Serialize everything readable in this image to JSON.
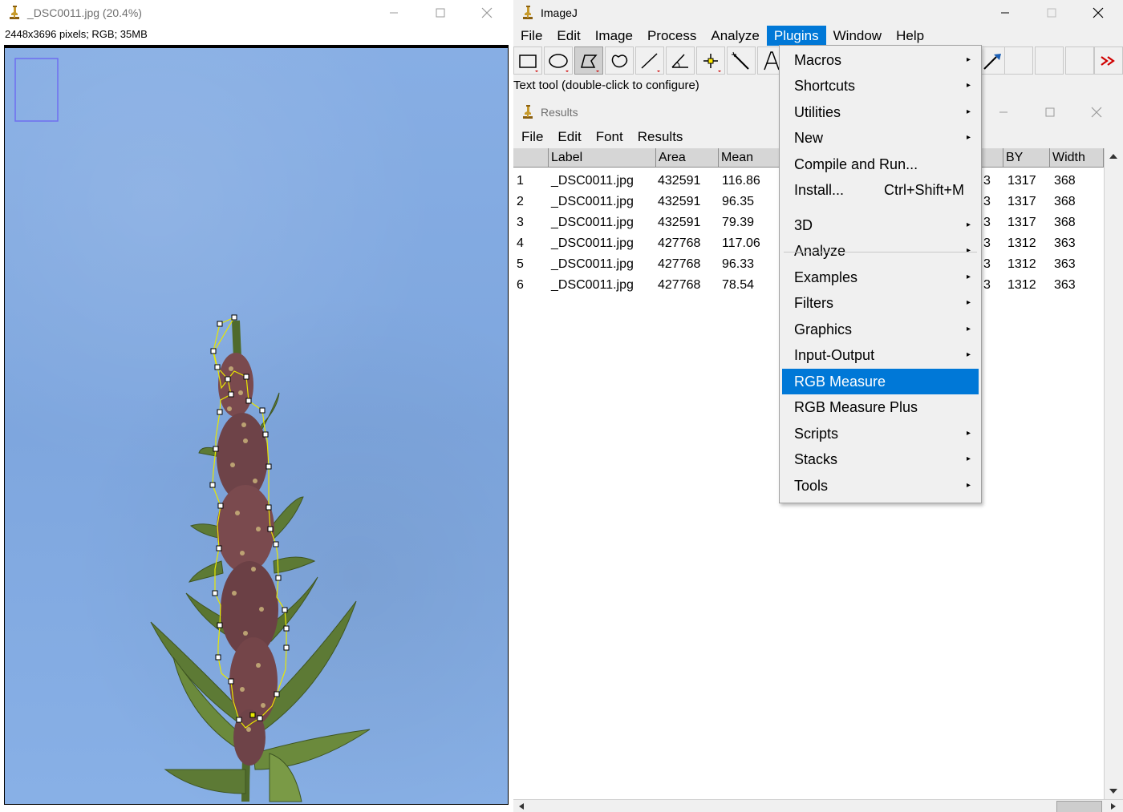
{
  "image_window": {
    "title": "_DSC0011.jpg (20.4%)",
    "info": "2448x3696 pixels; RGB; 35MB"
  },
  "imagej_window": {
    "title": "ImageJ",
    "menu": [
      "File",
      "Edit",
      "Image",
      "Process",
      "Analyze",
      "Plugins",
      "Window",
      "Help"
    ],
    "active_menu": "Plugins",
    "status": "Text tool (double-click to configure)",
    "tools": [
      "rectangle-tool",
      "oval-tool",
      "polygon-tool",
      "freehand-tool",
      "line-tool",
      "angle-tool",
      "point-tool",
      "wand-tool",
      "text-tool",
      "dropper-tool",
      "more-tools"
    ]
  },
  "results_window": {
    "title": "Results",
    "menu": [
      "File",
      "Edit",
      "Font",
      "Results"
    ],
    "columns": [
      "Label",
      "Area",
      "Mean",
      "BY",
      "Width"
    ],
    "rows": [
      {
        "num": "1",
        "label": "_DSC0011.jpg",
        "area": "432591",
        "mean": "116.86",
        "bx": "3",
        "by": "1317",
        "width": "368"
      },
      {
        "num": "2",
        "label": "_DSC0011.jpg",
        "area": "432591",
        "mean": "96.35",
        "bx": "3",
        "by": "1317",
        "width": "368"
      },
      {
        "num": "3",
        "label": "_DSC0011.jpg",
        "area": "432591",
        "mean": "79.39",
        "bx": "3",
        "by": "1317",
        "width": "368"
      },
      {
        "num": "4",
        "label": "_DSC0011.jpg",
        "area": "427768",
        "mean": "117.06",
        "bx": "3",
        "by": "1312",
        "width": "363"
      },
      {
        "num": "5",
        "label": "_DSC0011.jpg",
        "area": "427768",
        "mean": "96.33",
        "bx": "3",
        "by": "1312",
        "width": "363"
      },
      {
        "num": "6",
        "label": "_DSC0011.jpg",
        "area": "427768",
        "mean": "78.54",
        "bx": "3",
        "by": "1312",
        "width": "363"
      }
    ]
  },
  "plugins_menu": {
    "items": [
      {
        "label": "Macros",
        "submenu": true
      },
      {
        "label": "Shortcuts",
        "submenu": true
      },
      {
        "label": "Utilities",
        "submenu": true
      },
      {
        "label": "New",
        "submenu": true
      },
      {
        "label": "Compile and Run...",
        "submenu": false
      },
      {
        "label": "Install...",
        "submenu": false,
        "accelerator": "Ctrl+Shift+M"
      },
      {
        "label": "3D",
        "submenu": true
      },
      {
        "label": "Analyze",
        "submenu": true
      },
      {
        "label": "Examples",
        "submenu": true
      },
      {
        "label": "Filters",
        "submenu": true
      },
      {
        "label": "Graphics",
        "submenu": true
      },
      {
        "label": "Input-Output",
        "submenu": true
      },
      {
        "label": "RGB Measure",
        "submenu": false,
        "highlighted": true
      },
      {
        "label": "RGB Measure Plus",
        "submenu": false
      },
      {
        "label": "Scripts",
        "submenu": true
      },
      {
        "label": "Stacks",
        "submenu": true
      },
      {
        "label": "Tools",
        "submenu": true
      }
    ]
  },
  "colors": {
    "highlight": "#0078d7",
    "background_blue": "#87aee4",
    "roi_outline": "#ffff00"
  }
}
